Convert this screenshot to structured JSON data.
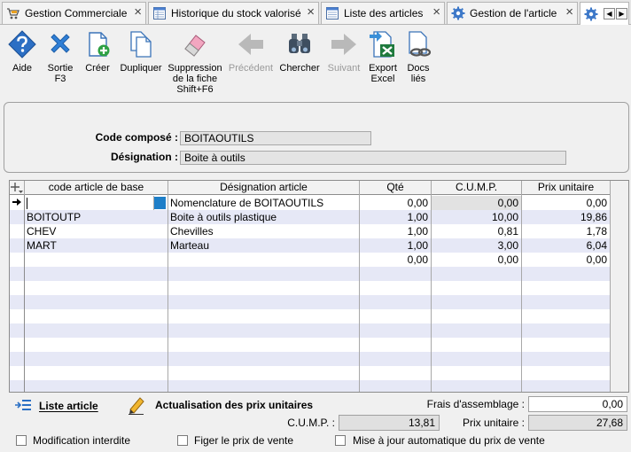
{
  "tabs": [
    {
      "label": "Gestion Commerciale",
      "icon": "cart-icon"
    },
    {
      "label": "Historique du stock valorisé",
      "icon": "grid-document-icon"
    },
    {
      "label": "Liste des articles",
      "icon": "list-document-icon"
    },
    {
      "label": "Gestion de l'article",
      "icon": "gear-icon"
    }
  ],
  "toolbar": {
    "aide": "Aide",
    "sortie": "Sortie",
    "sortie_key": "F3",
    "creer": "Créer",
    "dupliquer": "Dupliquer",
    "suppression_1": "Suppression",
    "suppression_2": "de la fiche",
    "suppression_3": "Shift+F6",
    "precedent": "Précédent",
    "chercher": "Chercher",
    "suivant": "Suivant",
    "export_1": "Export",
    "export_2": "Excel",
    "docs_1": "Docs",
    "docs_2": "liés"
  },
  "form": {
    "code_label": "Code composé :",
    "code_value": "BOITAOUTILS",
    "designation_label": "Désignation :",
    "designation_value": "Boite à outils"
  },
  "grid": {
    "headers": {
      "code": "code article de base",
      "designation": "Désignation article",
      "qte": "Qté",
      "cump": "C.U.M.P.",
      "prix": "Prix unitaire"
    },
    "rows": [
      {
        "code": "",
        "designation": "Nomenclature de BOITAOUTILS",
        "qte": "0,00",
        "cump": "0,00",
        "prix": "0,00"
      },
      {
        "code": "BOITOUTP",
        "designation": "Boite à outils plastique",
        "qte": "1,00",
        "cump": "10,00",
        "prix": "19,86"
      },
      {
        "code": "CHEV",
        "designation": "Chevilles",
        "qte": "1,00",
        "cump": "0,81",
        "prix": "1,78"
      },
      {
        "code": "MART",
        "designation": "Marteau",
        "qte": "1,00",
        "cump": "3,00",
        "prix": "6,04"
      },
      {
        "code": "",
        "designation": "",
        "qte": "0,00",
        "cump": "0,00",
        "prix": "0,00"
      }
    ]
  },
  "bottom": {
    "liste_article": "Liste article",
    "actualisation": "Actualisation des prix unitaires",
    "frais_label": "Frais d'assemblage :",
    "frais_value": "0,00",
    "cump_label": "C.U.M.P. :",
    "cump_value": "13,81",
    "prix_label": "Prix unitaire :",
    "prix_value": "27,68",
    "check_modification": "Modification interdite",
    "check_figer": "Figer le prix de vente",
    "check_maj": "Mise à jour automatique du prix de vente"
  },
  "colors": {
    "accent_blue": "#1e6fd0",
    "row_alt": "#e6e8f6",
    "cursor_cell": "#1e7fc8"
  }
}
